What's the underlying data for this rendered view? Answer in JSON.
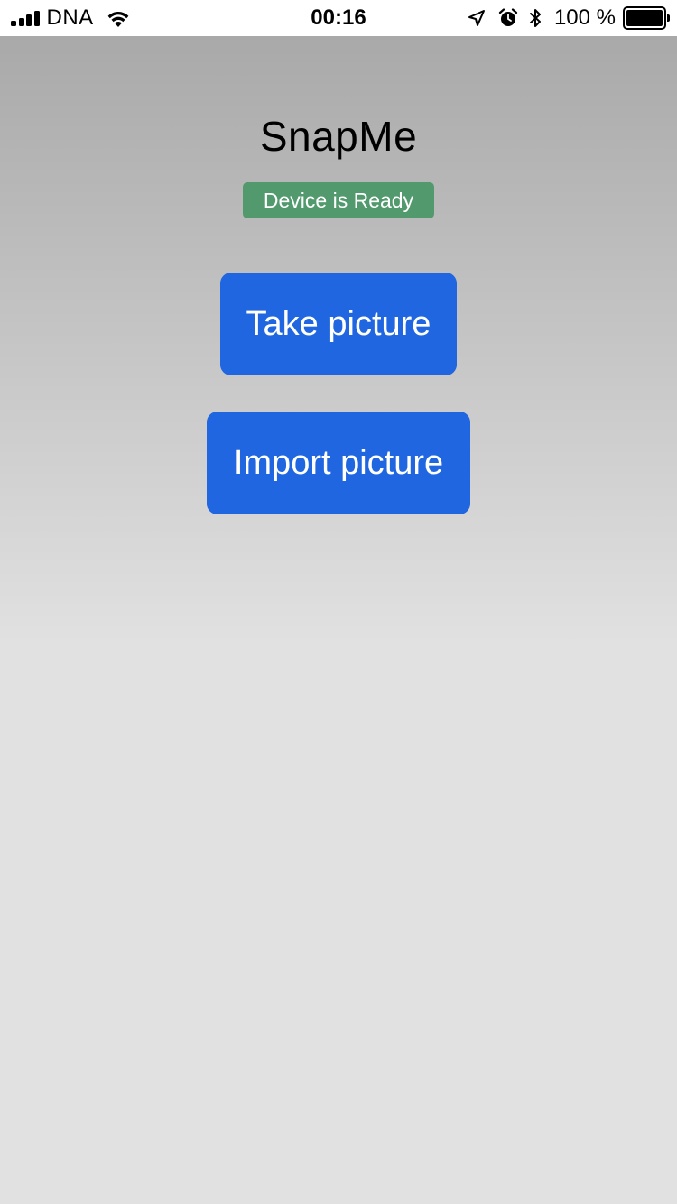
{
  "status_bar": {
    "carrier": "DNA",
    "time": "00:16",
    "battery_percent": "100 %",
    "icons": [
      "signal-icon",
      "wifi-icon",
      "location-arrow-icon",
      "alarm-icon",
      "bluetooth-icon",
      "battery-icon"
    ]
  },
  "app": {
    "title": "SnapMe",
    "status_badge": "Device is Ready",
    "take_picture_label": "Take picture",
    "import_picture_label": "Import picture"
  },
  "colors": {
    "button_blue": "#1f66e0",
    "badge_green": "#529a6d",
    "background_top": "#a9a9a9",
    "background_bottom": "#e1e1e1"
  }
}
